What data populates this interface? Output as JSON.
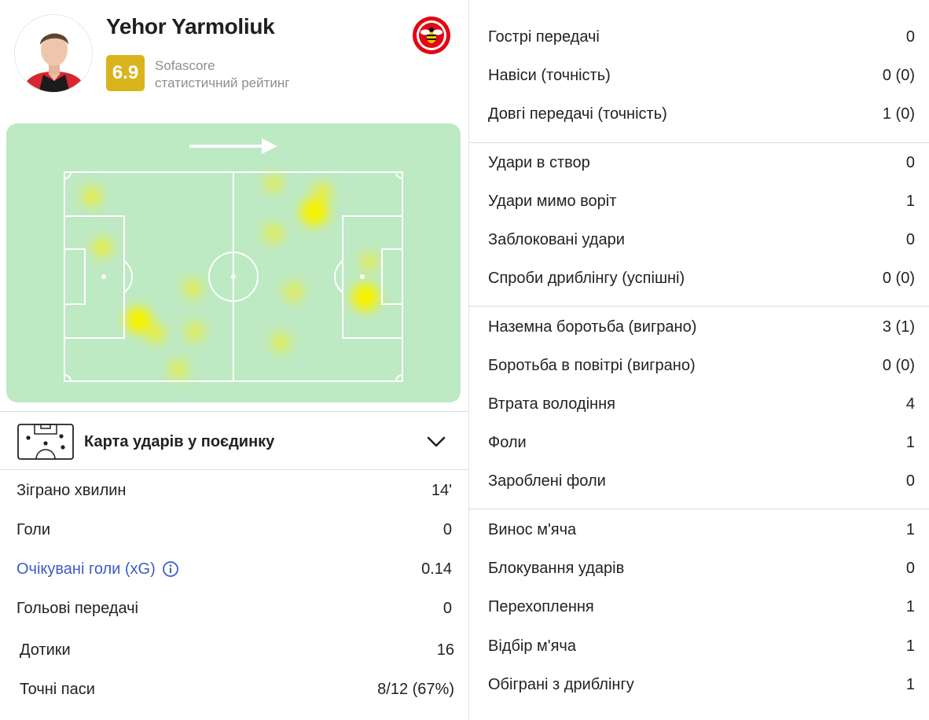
{
  "player": {
    "name": "Yehor Yarmoliuk",
    "rating": "6.9",
    "rating_source": "Sofascore",
    "rating_label": "статистичний рейтинг"
  },
  "colors": {
    "rating_badge": "#d9b41d",
    "pitch": "#bde9c3",
    "heat": "#f5f000",
    "xg_link": "#3d5cc4"
  },
  "heatmap": {
    "direction_icon": "arrow-right-icon"
  },
  "shotmap": {
    "label": "Карта ударів у поєдинку",
    "icon": "pitch-shot-icon",
    "toggle_icon": "chevron-down-icon"
  },
  "left_stats": [
    {
      "label": "Зіграно хвилин",
      "value": "14'"
    },
    {
      "label": "Голи",
      "value": "0"
    },
    {
      "label": "Очікувані голи (xG)",
      "value": "0.14"
    },
    {
      "label": "Гольові передачі",
      "value": "0"
    },
    {
      "label": "Дотики",
      "value": "16"
    },
    {
      "label": "Точні паси",
      "value": "8/12 (67%)"
    }
  ],
  "right_groups": [
    [
      {
        "label": "Гострі передачі",
        "value": "0"
      },
      {
        "label": "Навіси (точність)",
        "value": "0 (0)"
      },
      {
        "label": "Довгі передачі (точність)",
        "value": "1 (0)"
      }
    ],
    [
      {
        "label": "Удари в створ",
        "value": "0"
      },
      {
        "label": "Удари мимо воріт",
        "value": "1"
      },
      {
        "label": "Заблоковані удари",
        "value": "0"
      },
      {
        "label": "Спроби дриблінгу (успішні)",
        "value": "0 (0)"
      }
    ],
    [
      {
        "label": "Наземна боротьба (виграно)",
        "value": "3 (1)"
      },
      {
        "label": "Боротьба в повітрі (виграно)",
        "value": "0 (0)"
      },
      {
        "label": "Втрата володіння",
        "value": "4"
      },
      {
        "label": "Фоли",
        "value": "1"
      },
      {
        "label": "Зароблені фоли",
        "value": "0"
      }
    ],
    [
      {
        "label": "Винос м'яча",
        "value": "1"
      },
      {
        "label": "Блокування ударів",
        "value": "0"
      },
      {
        "label": "Перехоплення",
        "value": "1"
      },
      {
        "label": "Відбір м'яча",
        "value": "1"
      },
      {
        "label": "Обіграні з дриблінгу",
        "value": "1"
      }
    ]
  ]
}
